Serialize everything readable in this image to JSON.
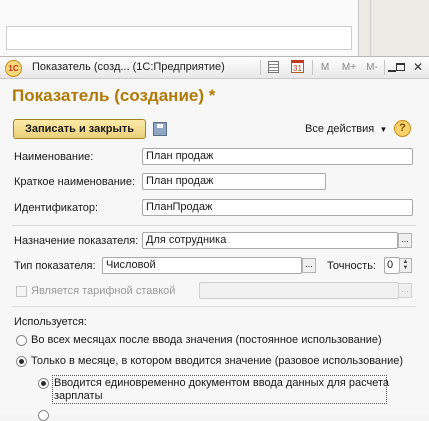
{
  "window": {
    "title": "Показатель (созд...  (1С:Предприятие)",
    "toolbar": [
      "М",
      "М+",
      "М-"
    ],
    "controls": [
      "minimize",
      "maximize",
      "close"
    ],
    "app_icon": "1c-logo-icon"
  },
  "form": {
    "heading": "Показатель (создание) *",
    "save_close_label": "Записать и закрыть",
    "all_actions_label": "Все действия",
    "help_label": "?"
  },
  "fields": {
    "name_label": "Наименование:",
    "name_value": "План продаж",
    "short_name_label": "Краткое наименование:",
    "short_name_value": "План продаж",
    "identifier_label": "Идентификатор:",
    "identifier_value": "ПланПродаж",
    "purpose_label": "Назначение показателя:",
    "purpose_value": "Для сотрудника",
    "type_label": "Тип показателя:",
    "type_value": "Числовой",
    "precision_label": "Точность:",
    "precision_value": "0",
    "tariff_label": "Является тарифной ставкой"
  },
  "usage": {
    "label": "Используется:",
    "options": [
      "Во всех месяцах после ввода значения (постоянное использование)",
      "Только в месяце, в котором вводится значение (разовое использование)"
    ],
    "selected": 1,
    "sub_option_line1": "Вводится единовременно документом ввода данных для расчета",
    "sub_option_line2": "зарплаты"
  }
}
